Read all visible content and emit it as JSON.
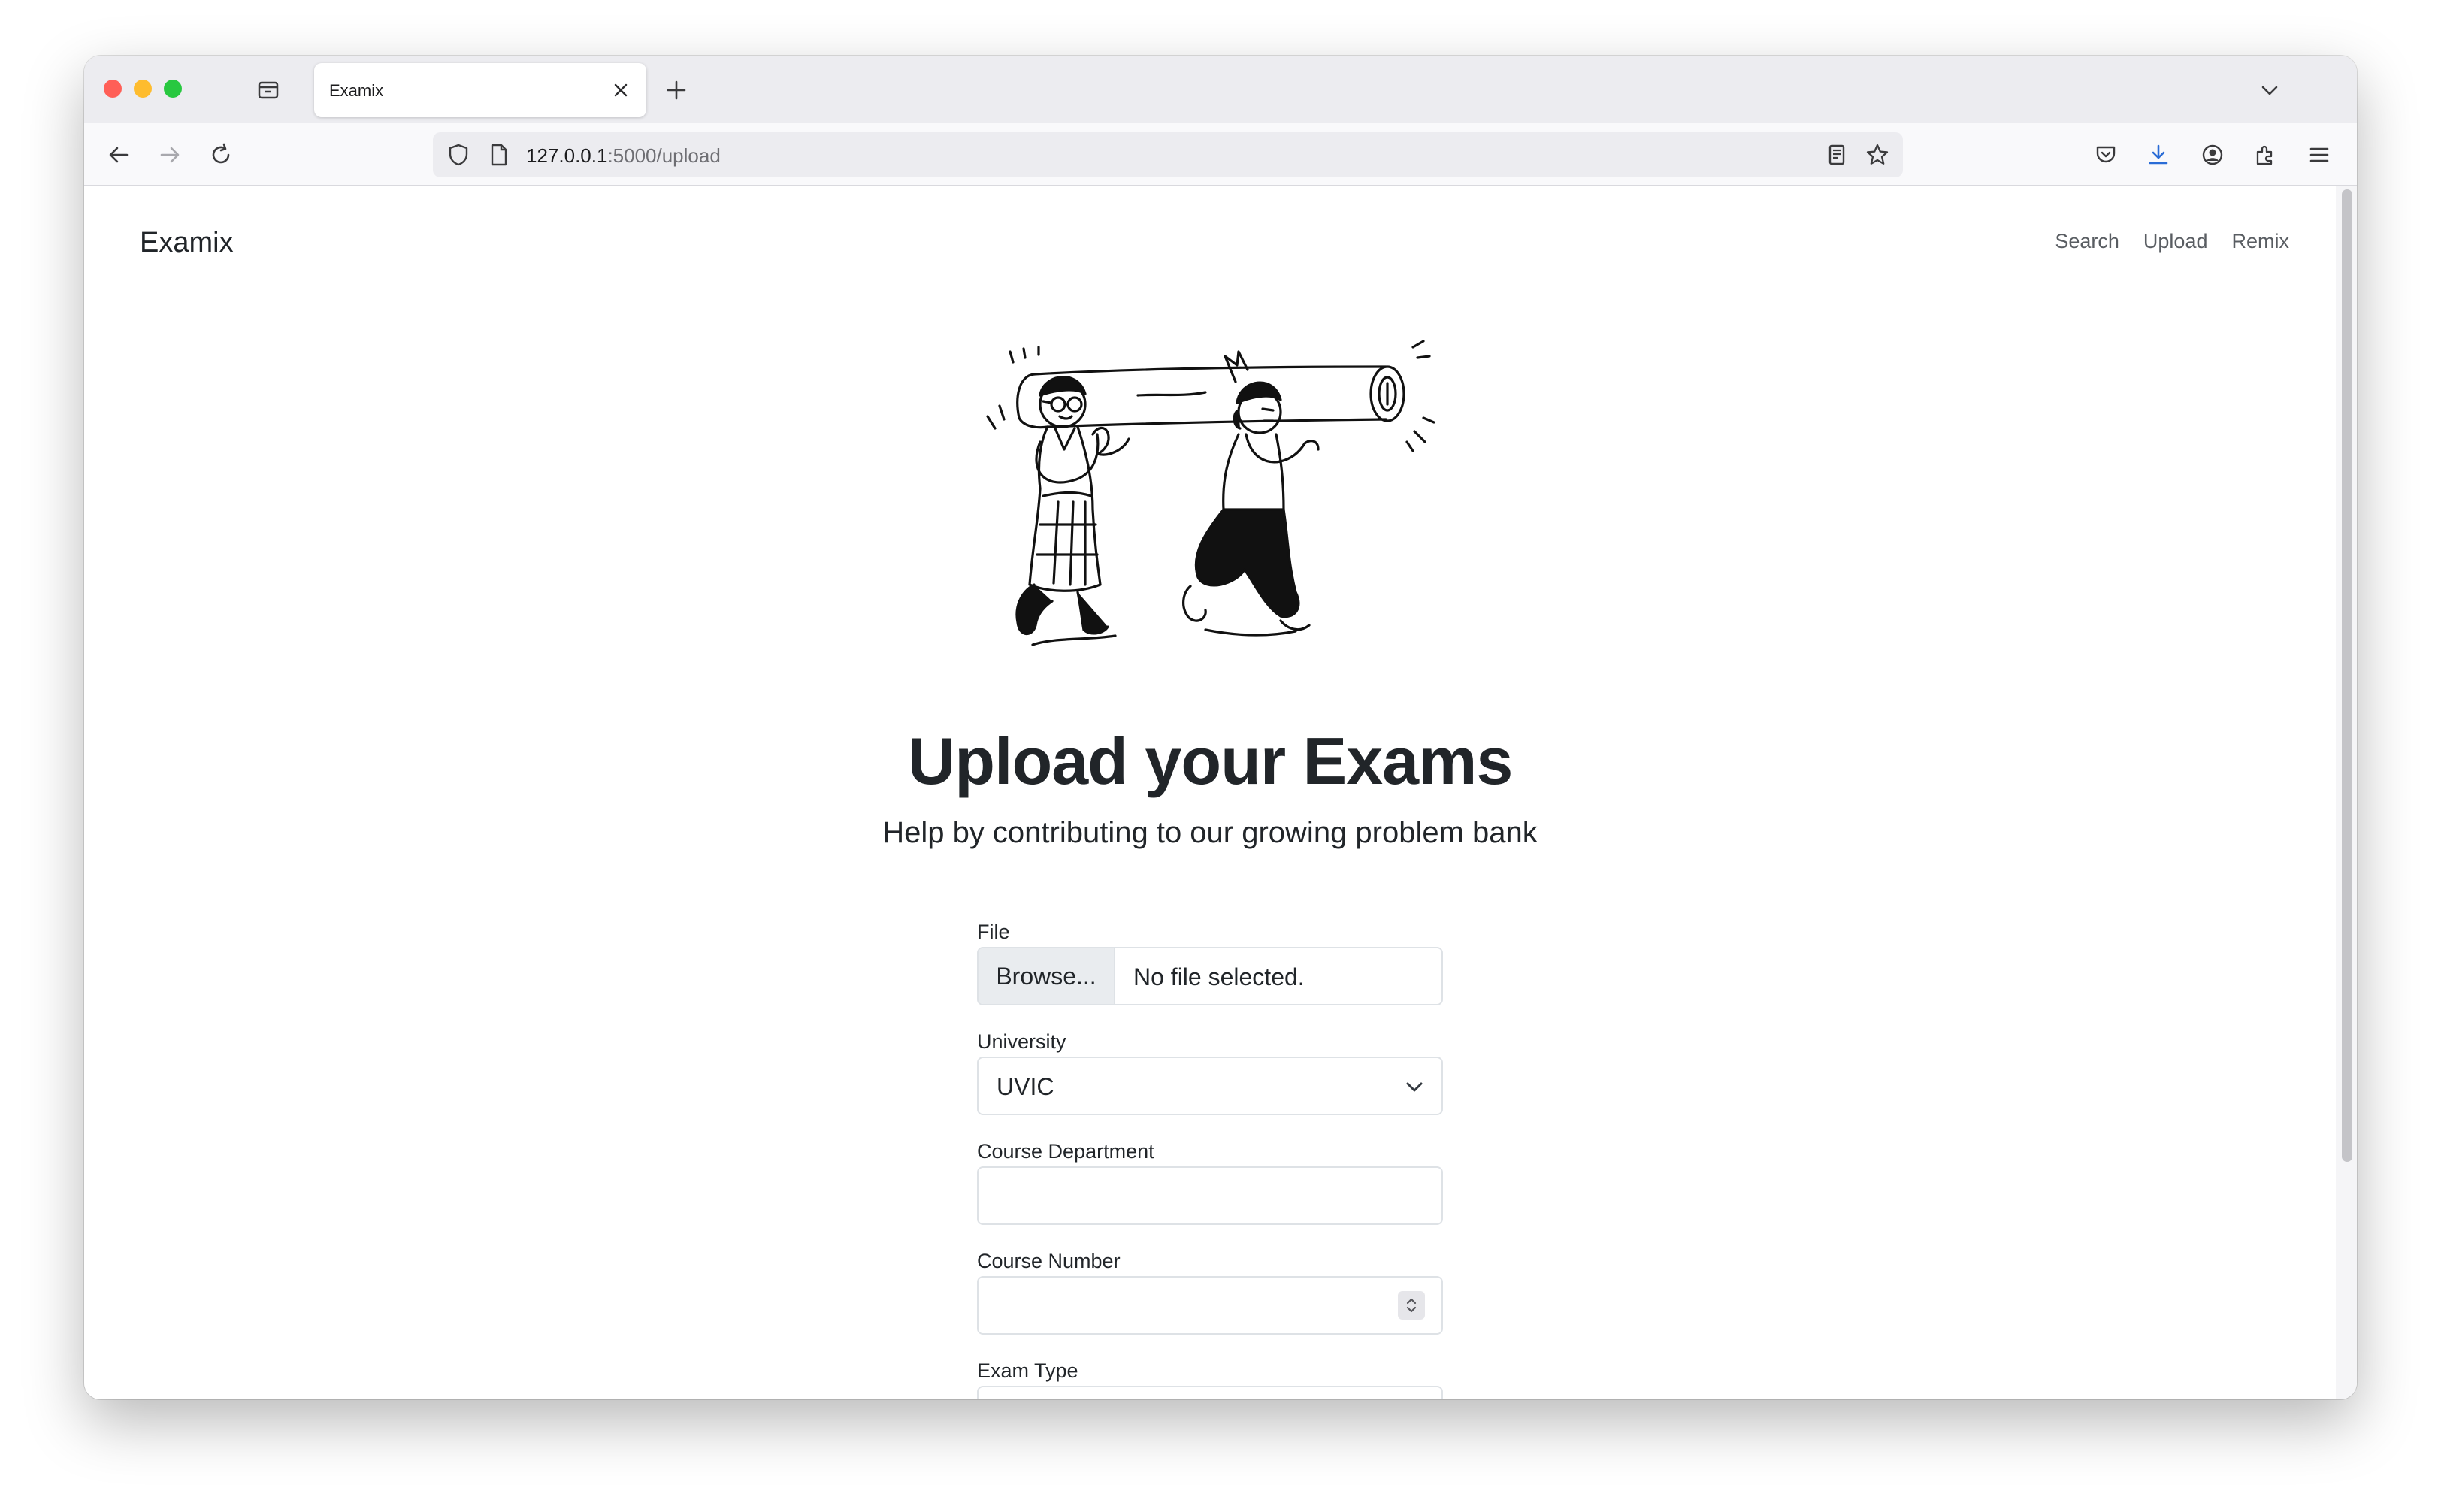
{
  "browser": {
    "tab_title": "Examix",
    "url_host": "127.0.0.1",
    "url_rest": ":5000/upload"
  },
  "site": {
    "brand": "Examix",
    "nav": [
      "Search",
      "Upload",
      "Remix"
    ]
  },
  "hero": {
    "title": "Upload your Exams",
    "subtitle": "Help by contributing to our growing problem bank"
  },
  "form": {
    "file_label": "File",
    "file_button": "Browse...",
    "file_status": "No file selected.",
    "university_label": "University",
    "university_value": "UVIC",
    "department_label": "Course Department",
    "department_value": "",
    "number_label": "Course Number",
    "number_value": "",
    "exam_type_label": "Exam Type"
  },
  "colors": {
    "text": "#212529",
    "nav_link": "#595d62",
    "input_border": "#dee2e6",
    "tab_strip": "#ececf0"
  }
}
